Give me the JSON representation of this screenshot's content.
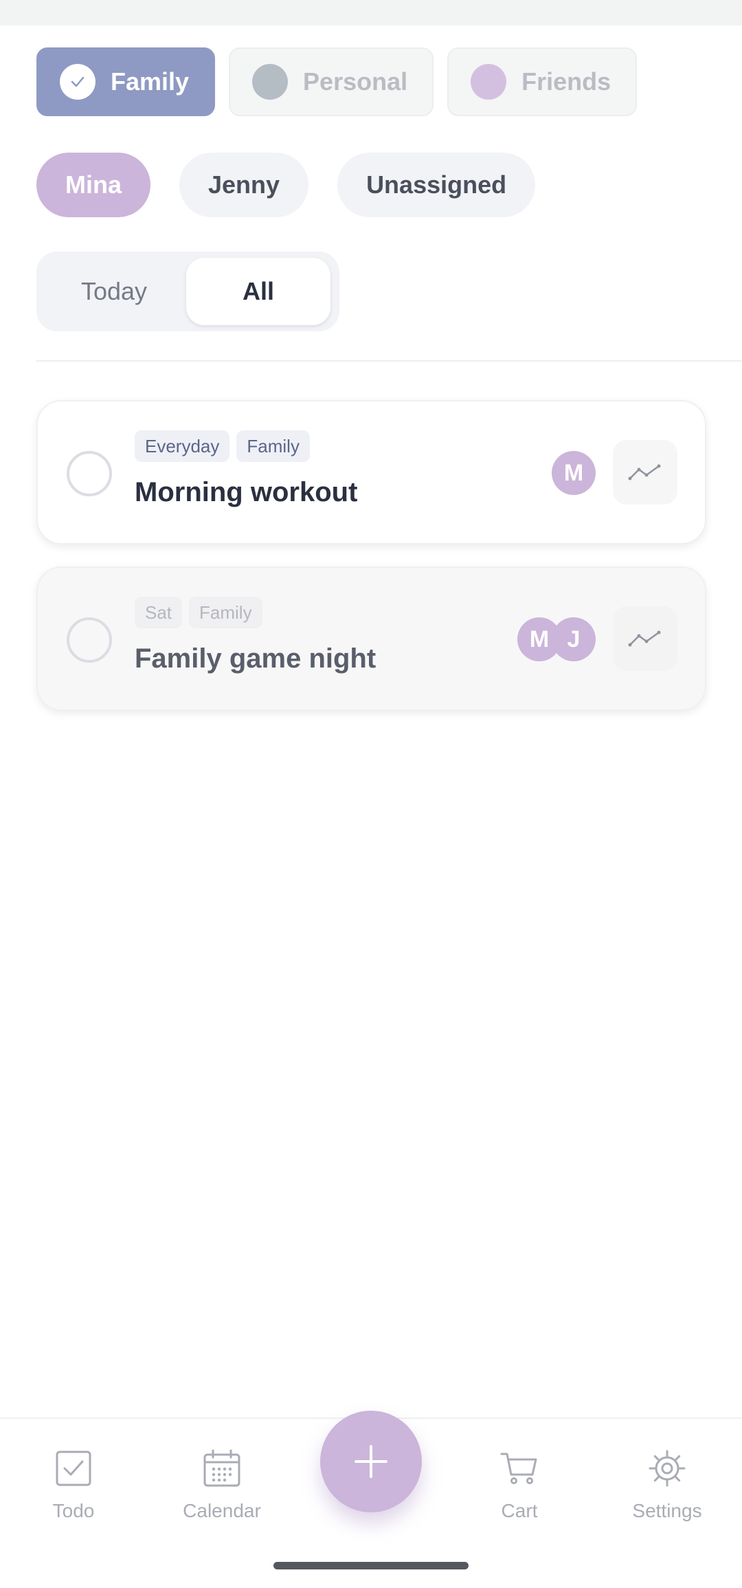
{
  "groups": [
    {
      "label": "Family",
      "active": true,
      "dot_color": "#ffffff",
      "accent": "#8e9ac3"
    },
    {
      "label": "Personal",
      "active": false,
      "dot_color": "#b4bcc4"
    },
    {
      "label": "Friends",
      "active": false,
      "dot_color": "#d3c0e0"
    }
  ],
  "members": [
    {
      "label": "Mina",
      "active": true
    },
    {
      "label": "Jenny",
      "active": false
    },
    {
      "label": "Unassigned",
      "active": false
    }
  ],
  "segment": {
    "today": "Today",
    "all": "All",
    "selected": "All"
  },
  "tasks": [
    {
      "tags": [
        "Everyday",
        "Family"
      ],
      "title": "Morning workout",
      "avatars": [
        "M"
      ],
      "completed": false
    },
    {
      "tags": [
        "Sat",
        "Family"
      ],
      "title": "Family game night",
      "avatars": [
        "M",
        "J"
      ],
      "completed": false
    }
  ],
  "nav": {
    "todo": "Todo",
    "calendar": "Calendar",
    "cart": "Cart",
    "settings": "Settings",
    "icons": [
      "checkbox-icon",
      "calendar-icon",
      "plus-icon",
      "cart-icon",
      "gear-icon"
    ]
  },
  "colors": {
    "accent_purple": "#cbb5da",
    "accent_blue": "#8e9ac3"
  }
}
